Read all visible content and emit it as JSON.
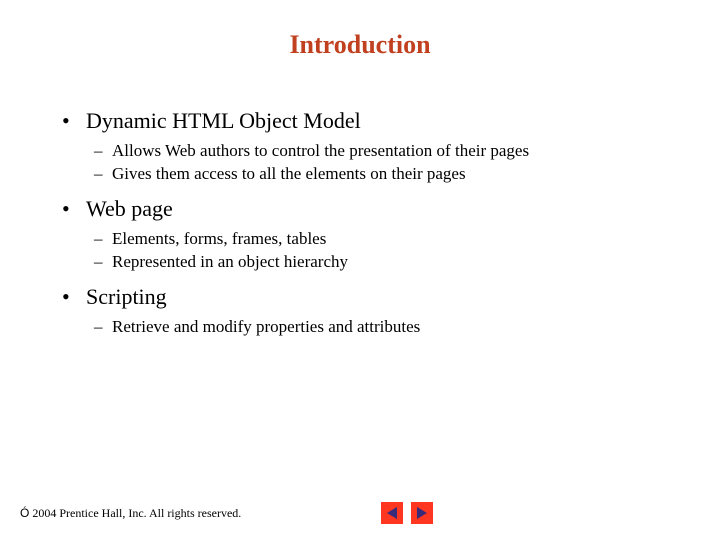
{
  "title": "Introduction",
  "bullets": [
    {
      "text": "Dynamic HTML Object Model",
      "subs": [
        "Allows Web authors to control the presentation of their pages",
        "Gives them access to all the elements on their pages"
      ]
    },
    {
      "text": "Web page",
      "subs": [
        "Elements, forms, frames, tables",
        "Represented in an object hierarchy"
      ]
    },
    {
      "text": "Scripting",
      "subs": [
        "Retrieve and modify properties and attributes"
      ]
    }
  ],
  "footer": {
    "copyright_symbol": "Ó",
    "copyright_text": " 2004 Prentice Hall, Inc. All rights reserved."
  }
}
